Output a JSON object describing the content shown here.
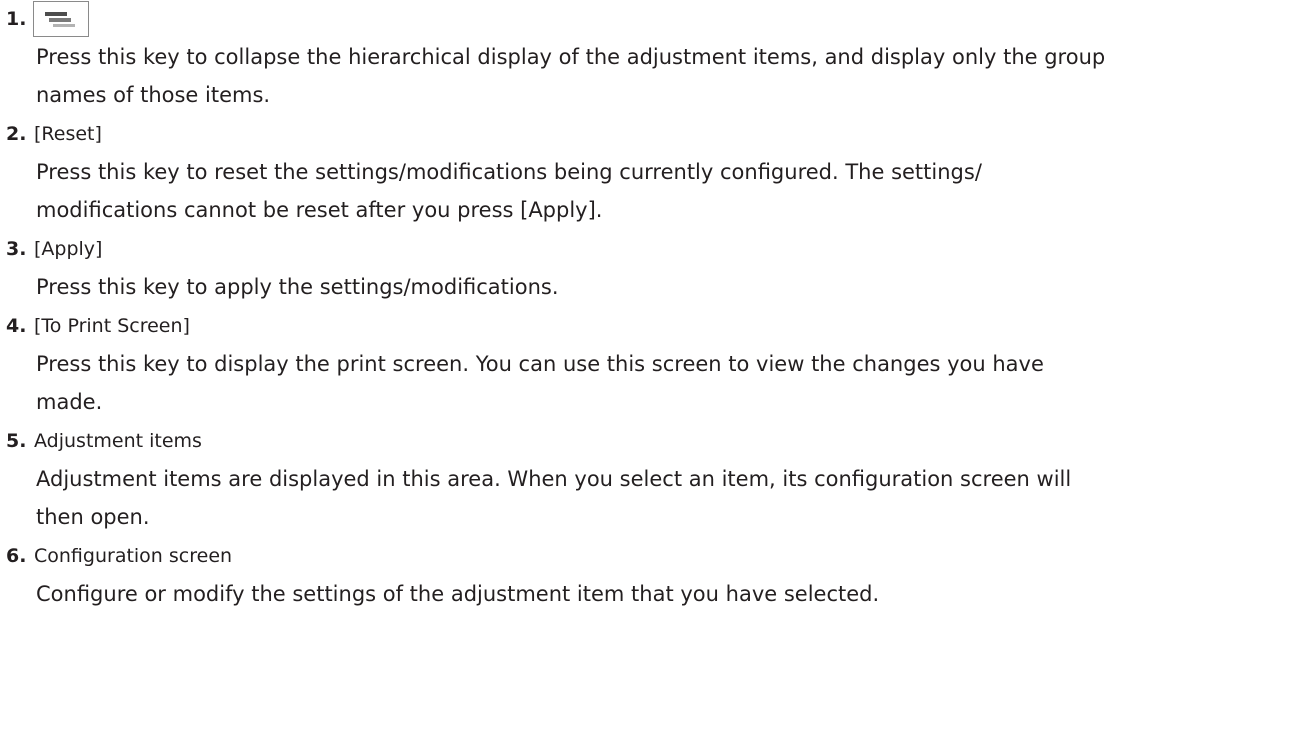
{
  "items": [
    {
      "number": "1.",
      "label": "",
      "icon": "collapse-icon",
      "lines": [
        "Press this key to collapse the hierarchical display of the adjustment items, and display only the group",
        "names of those items."
      ]
    },
    {
      "number": "2.",
      "label": "[Reset]",
      "lines": [
        "Press this key to reset the settings/modifications being currently configured. The settings/",
        "modifications cannot be reset after you press [Apply]."
      ]
    },
    {
      "number": "3.",
      "label": "[Apply]",
      "lines": [
        "Press this key to apply the settings/modifications."
      ]
    },
    {
      "number": "4.",
      "label": "[To Print Screen]",
      "lines": [
        "Press this key to display the print screen. You can use this screen to view the changes you have",
        "made."
      ]
    },
    {
      "number": "5.",
      "label": "Adjustment items",
      "lines": [
        "Adjustment items are displayed in this area. When you select an item, its configuration screen will",
        "then open."
      ]
    },
    {
      "number": "6.",
      "label": "Configuration screen",
      "lines": [
        "Configure or modify the settings of the adjustment item that you have selected."
      ]
    }
  ]
}
